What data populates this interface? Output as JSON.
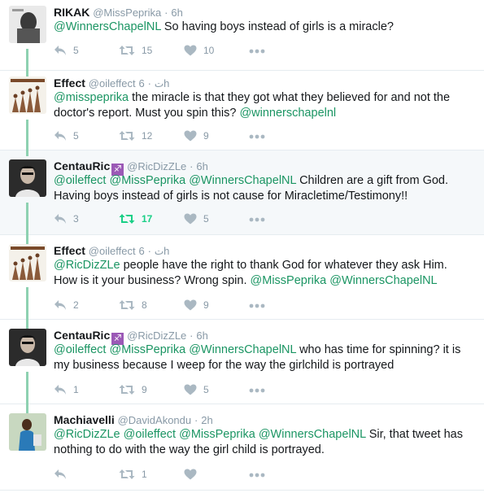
{
  "tweets": [
    {
      "name": "RIKAK",
      "handle": "@MissPeprika",
      "time": "6h",
      "text": [
        {
          "t": "@WinnersChapelNL",
          "m": true
        },
        {
          "t": " So having boys instead of girls is a miracle?",
          "m": false
        }
      ],
      "replies": "5",
      "retweets": "15",
      "likes": "10"
    },
    {
      "name": "Effect",
      "handle": "@oileffect",
      "suffix": "ت",
      "time": "6h",
      "text": [
        {
          "t": "@misspeprika",
          "m": true
        },
        {
          "t": " the miracle is that they got what they believed for and not the doctor's report. Must you spin this? ",
          "m": false
        },
        {
          "t": "@winnerschapelnl",
          "m": true
        }
      ],
      "replies": "5",
      "retweets": "12",
      "likes": "9"
    },
    {
      "name": "CentauRic",
      "badge": "♐",
      "handle": "@RicDizZLe",
      "time": "6h",
      "text": [
        {
          "t": "@oileffect",
          "m": true
        },
        {
          "t": " ",
          "m": false
        },
        {
          "t": "@MissPeprika",
          "m": true
        },
        {
          "t": " ",
          "m": false
        },
        {
          "t": "@WinnersChapelNL",
          "m": true
        },
        {
          "t": " Children are a gift from God. Having boys instead of girls is not cause for Miracletime/Testimony!!",
          "m": false
        }
      ],
      "replies": "3",
      "retweets": "17",
      "likes": "5"
    },
    {
      "name": "Effect",
      "handle": "@oileffect",
      "suffix": "ت",
      "time": "6h",
      "text": [
        {
          "t": "@RicDizZLe",
          "m": true
        },
        {
          "t": " people have the right to thank God for whatever they ask Him. How is it your business? Wrong spin. ",
          "m": false
        },
        {
          "t": "@MissPeprika",
          "m": true
        },
        {
          "t": " ",
          "m": false
        },
        {
          "t": "@WinnersChapelNL",
          "m": true
        }
      ],
      "replies": "2",
      "retweets": "8",
      "likes": "9"
    },
    {
      "name": "CentauRic",
      "badge": "♐",
      "handle": "@RicDizZLe",
      "time": "6h",
      "text": [
        {
          "t": "@oileffect",
          "m": true
        },
        {
          "t": " ",
          "m": false
        },
        {
          "t": "@MissPeprika",
          "m": true
        },
        {
          "t": " ",
          "m": false
        },
        {
          "t": "@WinnersChapelNL",
          "m": true
        },
        {
          "t": " who has time for spinning? it is my business because I weep for the way the girlchild is portrayed",
          "m": false
        }
      ],
      "replies": "1",
      "retweets": "9",
      "likes": "5"
    },
    {
      "name": "Machiavelli",
      "handle": "@DavidAkondu",
      "time": "2h",
      "text": [
        {
          "t": "@RicDizZLe",
          "m": true
        },
        {
          "t": " ",
          "m": false
        },
        {
          "t": "@oileffect",
          "m": true
        },
        {
          "t": " ",
          "m": false
        },
        {
          "t": "@MissPeprika",
          "m": true
        },
        {
          "t": " ",
          "m": false
        },
        {
          "t": "@WinnersChapelNL",
          "m": true
        },
        {
          "t": " Sir, that tweet has nothing to do with the way the girl child is portrayed.",
          "m": false
        }
      ],
      "replies": "",
      "retweets": "1",
      "likes": ""
    }
  ],
  "dot": "·",
  "colors": {
    "mention": "#1b9563",
    "retweet_active": "#19cf86",
    "thread_line": "#8ed1b1",
    "icon": "#aab8c2"
  },
  "icons": {
    "reply": "reply-icon",
    "retweet": "retweet-icon",
    "like": "heart-icon",
    "more": "more-icon"
  }
}
